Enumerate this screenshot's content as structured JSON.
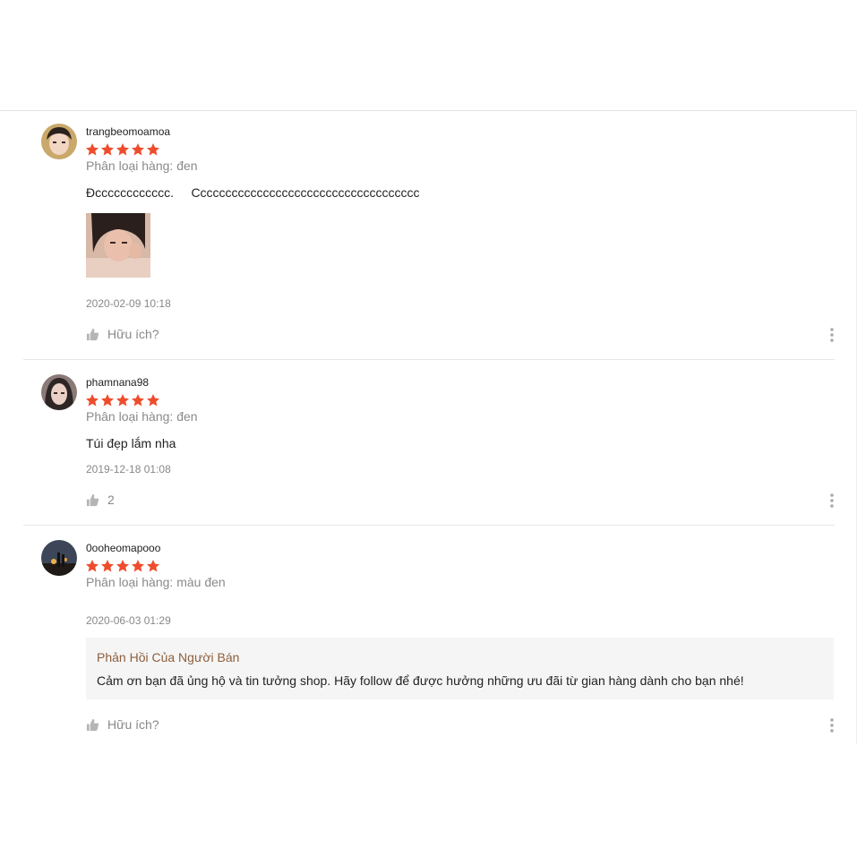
{
  "colors": {
    "star": "#ee4d2d",
    "muted_text": "#888888",
    "seller_reply_title": "#8d5e3b",
    "reply_background": "#f5f5f5"
  },
  "reviews": [
    {
      "username": "trangbeomoamoa",
      "rating": 5,
      "variation": "Phân loại hàng: đen",
      "comment": "Đcccccccccccc.     Cccccccccccccccccccccccccccccccccccc",
      "has_photo": true,
      "timestamp": "2020-02-09 10:18",
      "likes_label": "Hữu ích?",
      "more_icon": "more-vertical-icon"
    },
    {
      "username": "phamnana98",
      "rating": 5,
      "variation": "Phân loại hàng: đen",
      "comment": "Túi đẹp lắm nha",
      "timestamp": "2019-12-18 01:08",
      "likes_label": "2",
      "more_icon": "more-vertical-icon"
    },
    {
      "username": "0ooheomapooo",
      "rating": 5,
      "variation": "Phân loại hàng: màu đen",
      "timestamp": "2020-06-03 01:29",
      "seller_reply": {
        "title": "Phản Hồi Của Người Bán",
        "text": "Cảm ơn bạn đã ủng hộ và tin tưởng shop. Hãy follow để được hưởng những ưu đãi từ gian hàng dành cho bạn nhé!"
      },
      "likes_label": "Hữu ích?",
      "more_icon": "more-vertical-icon"
    }
  ]
}
